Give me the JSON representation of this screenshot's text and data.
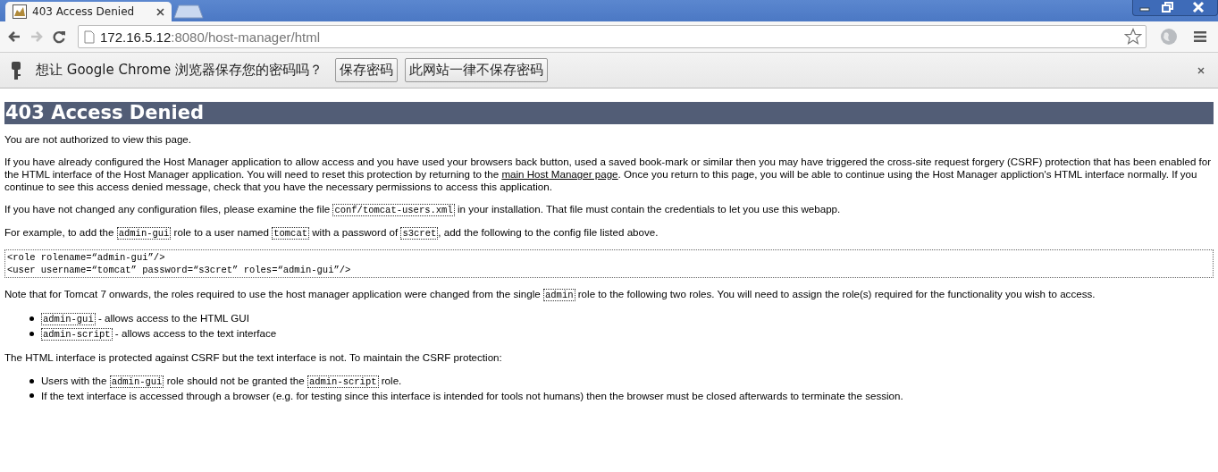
{
  "browser": {
    "tabs": [
      {
        "title": "403 Access Denied",
        "selected": true
      }
    ],
    "toolbar": {
      "back_disabled": false,
      "forward_disabled": true
    },
    "address": {
      "host": "172.16.5.12",
      "rest": ":8080/host-manager/html"
    },
    "infobar": {
      "message": "想让 Google Chrome 浏览器保存您的密码吗？",
      "buttons": [
        "保存密码",
        "此网站一律不保存密码"
      ]
    }
  },
  "page": [
    {
      "kind": "heading",
      "text": "403 Access Denied"
    },
    {
      "kind": "paragraph",
      "segments": [
        {
          "kind": "text",
          "text": "You are not authorized to view this page."
        }
      ]
    },
    {
      "kind": "paragraph",
      "segments": [
        {
          "kind": "text",
          "text": "If you have already configured the Host Manager application to allow access and you have used your browsers back button, used a saved book-mark or similar then you may have triggered the cross-site request forgery (CSRF) protection that has been enabled for the HTML interface of the Host Manager application. You will need to reset this protection by returning to the "
        },
        {
          "kind": "link",
          "text": "main Host Manager page"
        },
        {
          "kind": "text",
          "text": ". Once you return to this page, you will be able to continue using the Host Manager appliction's HTML interface normally. If you continue to see this access denied message, check that you have the necessary permissions to access this application."
        }
      ]
    },
    {
      "kind": "paragraph",
      "segments": [
        {
          "kind": "text",
          "text": "If you have not changed any configuration files, please examine the file "
        },
        {
          "kind": "code",
          "text": "conf/tomcat-users.xml"
        },
        {
          "kind": "text",
          "text": " in your installation. That file must contain the credentials to let you use this webapp."
        }
      ]
    },
    {
      "kind": "paragraph",
      "segments": [
        {
          "kind": "text",
          "text": "For example, to add the "
        },
        {
          "kind": "code",
          "text": "admin-gui"
        },
        {
          "kind": "text",
          "text": " role to a user named "
        },
        {
          "kind": "code",
          "text": "tomcat"
        },
        {
          "kind": "text",
          "text": " with a password of "
        },
        {
          "kind": "code",
          "text": "s3cret"
        },
        {
          "kind": "text",
          "text": ", add the following to the config file listed above."
        }
      ]
    },
    {
      "kind": "pre",
      "lines": [
        "<role rolename=“admin-gui”/>",
        "<user username=“tomcat” password=“s3cret” roles=“admin-gui”/>"
      ]
    },
    {
      "kind": "paragraph",
      "segments": [
        {
          "kind": "text",
          "text": "Note that for Tomcat 7 onwards, the roles required to use the host manager application were changed from the single "
        },
        {
          "kind": "code",
          "text": "admin"
        },
        {
          "kind": "text",
          "text": " role to the following two roles. You will need to assign the role(s) required for the functionality you wish to access."
        }
      ]
    },
    {
      "kind": "list",
      "items": [
        [
          {
            "kind": "code",
            "text": "admin-gui"
          },
          {
            "kind": "text",
            "text": " - allows access to the HTML GUI"
          }
        ],
        [
          {
            "kind": "code",
            "text": "admin-script"
          },
          {
            "kind": "text",
            "text": " - allows access to the text interface"
          }
        ]
      ]
    },
    {
      "kind": "paragraph",
      "segments": [
        {
          "kind": "text",
          "text": "The HTML interface is protected against CSRF but the text interface is not. To maintain the CSRF protection:"
        }
      ]
    },
    {
      "kind": "list",
      "items": [
        [
          {
            "kind": "text",
            "text": "Users with the "
          },
          {
            "kind": "code",
            "text": "admin-gui"
          },
          {
            "kind": "text",
            "text": " role should not be granted the "
          },
          {
            "kind": "code",
            "text": "admin-script"
          },
          {
            "kind": "text",
            "text": " role."
          }
        ],
        [
          {
            "kind": "text",
            "text": "If the text interface is accessed through a browser (e.g. for testing since this interface is intended for tools not humans) then the browser must be closed afterwards to terminate the session."
          }
        ]
      ]
    }
  ]
}
